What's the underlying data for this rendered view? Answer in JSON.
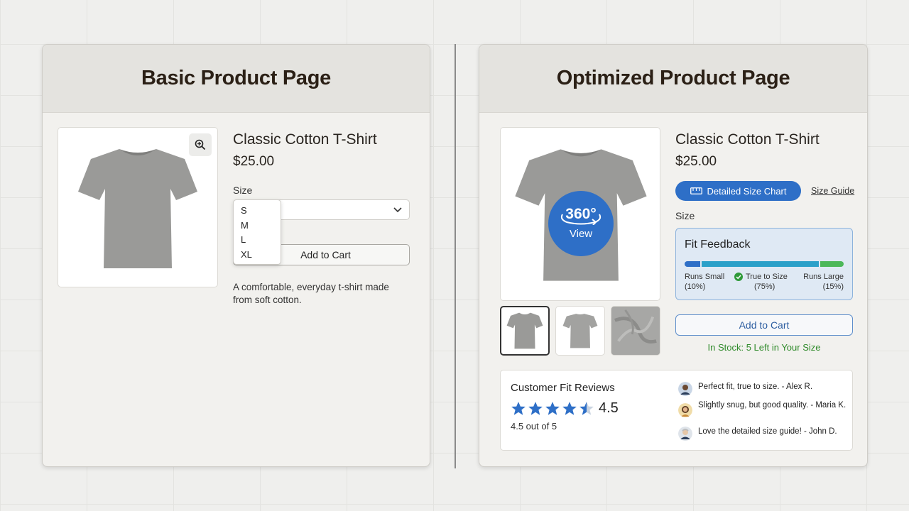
{
  "basic": {
    "title": "Basic Product Page",
    "product": {
      "name": "Classic Cotton T-Shirt",
      "price": "$25.00",
      "size_label": "Size",
      "size_options": [
        "S",
        "M",
        "L",
        "XL"
      ],
      "add_to_cart": "Add to Cart",
      "description": "A comfortable, everyday t-shirt made from soft cotton."
    },
    "icons": {
      "zoom": "zoom-in-icon",
      "chevron": "chevron-down-icon"
    }
  },
  "optimized": {
    "title": "Optimized Product Page",
    "product": {
      "name": "Classic Cotton T-Shirt",
      "price": "$25.00",
      "badge_360": "360°",
      "badge_view": "View",
      "size_chart_button": "Detailed Size Chart",
      "size_guide_link": "Size Guide",
      "size_label": "Size",
      "add_to_cart": "Add to Cart",
      "stock_status": "In Stock: 5 Left in Your Size"
    },
    "thumbnails": [
      "front-view",
      "back-view",
      "fabric-closeup"
    ],
    "fit_feedback": {
      "title": "Fit Feedback",
      "segments": [
        {
          "label": "Runs Small",
          "pct_label": "(10%)",
          "value": 10,
          "color": "#2e6fc7"
        },
        {
          "label": "True to Size",
          "pct_label": "(75%)",
          "value": 75,
          "color": "#2ba0c9"
        },
        {
          "label": "Runs Large",
          "pct_label": "(15%)",
          "value": 15,
          "color": "#4cb85a"
        }
      ]
    },
    "reviews": {
      "title": "Customer Fit Reviews",
      "rating": "4.5",
      "rating_value": 4.5,
      "rating_sub": "4.5 out of 5",
      "items": [
        {
          "text": "Perfect fit, true to size. - Alex R."
        },
        {
          "text": "Slightly snug, but good quality. - Maria K."
        },
        {
          "text": "Love the detailed size guide! - John D."
        }
      ]
    },
    "icons": {
      "ruler": "ruler-icon",
      "check": "check-circle-icon",
      "star": "star-icon",
      "rotate": "rotate-360-icon"
    }
  },
  "colors": {
    "primary_blue": "#2e6fc7",
    "success_green": "#2f8a2a",
    "star_blue": "#2e6fc7"
  }
}
